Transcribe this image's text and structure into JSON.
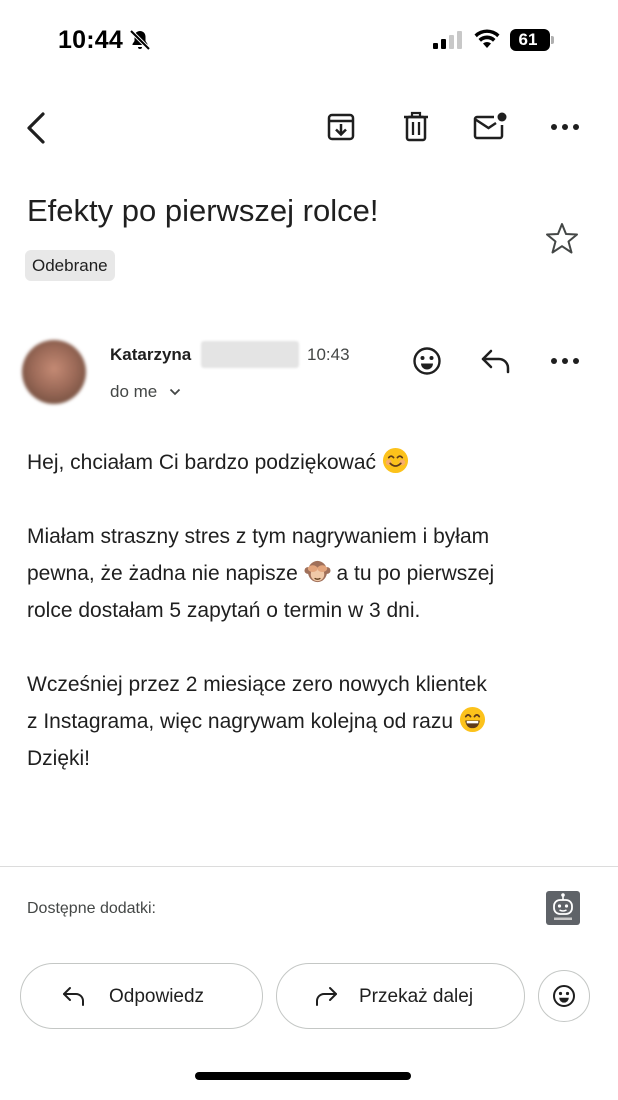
{
  "status_bar": {
    "time": "10:44",
    "battery": "61",
    "icons": [
      "bell-slash-icon",
      "cellular-signal-icon",
      "wifi-icon",
      "battery-icon"
    ]
  },
  "toolbar": {
    "icons": [
      "back-arrow-icon",
      "archive-icon",
      "trash-icon",
      "mark-unread-icon",
      "more-horizontal-icon"
    ]
  },
  "email": {
    "subject": "Efekty po pierwszej rolce!",
    "label": "Odebrane",
    "sender_name": "Katarzyna",
    "time": "10:43",
    "recipient": "do me",
    "body_paragraph_1": "Hej, chciałam Ci bardzo podziękować",
    "body_paragraph_2a": "Miałam straszny stres z tym nagrywaniem i byłam\npewna, że żadna nie napisze",
    "body_paragraph_2b": " a tu po pierwszej\nrolce dostałam 5 zapytań o termin w 3 dni.",
    "body_paragraph_3a": "Wcześniej przez 2 miesiące zero nowych klientek\nz Instagrama, więc nagrywam kolejną od razu",
    "body_paragraph_3b": "\nDzięki!"
  },
  "addons": {
    "label": "Dostępne dodatki:"
  },
  "actions": {
    "reply_label": "Odpowiedz",
    "forward_label": "Przekaż dalej"
  },
  "colors": {
    "text": "#1f1f1f",
    "secondary_text": "#444746",
    "chip_bg": "#e8e8e8",
    "border": "#c4c7c5"
  }
}
